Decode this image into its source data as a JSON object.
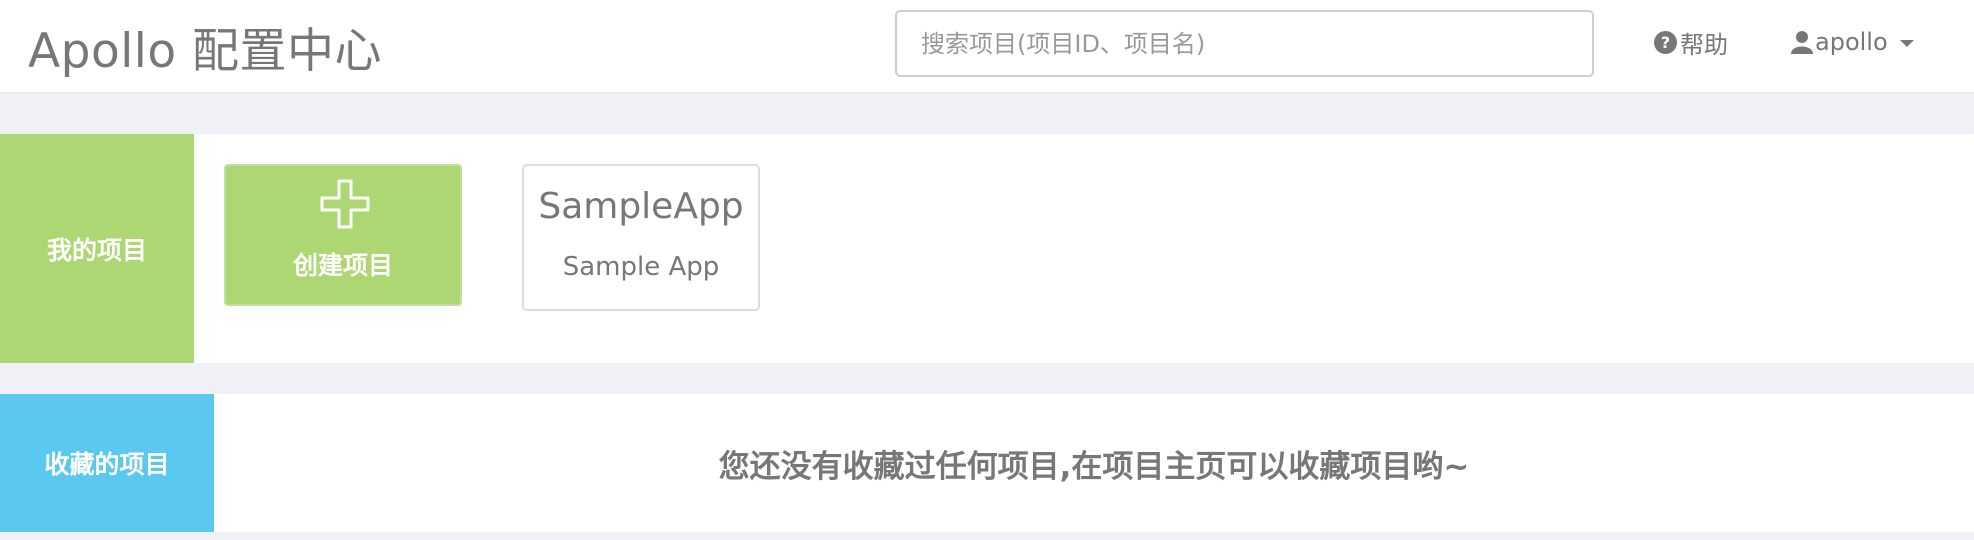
{
  "header": {
    "brand": "Apollo 配置中心",
    "search_placeholder": "搜索项目(项目ID、项目名)",
    "help_label": "帮助",
    "user_label": "apollo"
  },
  "my_projects": {
    "section_label": "我的项目",
    "create_label": "创建项目",
    "apps": [
      {
        "app_id": "SampleApp",
        "name": "Sample App"
      }
    ]
  },
  "favorites": {
    "section_label": "收藏的项目",
    "empty_message": "您还没有收藏过任何项目,在项目主页可以收藏项目哟~"
  },
  "colors": {
    "my_projects_accent": "#acd772",
    "favorites_accent": "#5bc9ef",
    "page_background": "#f0f1f6"
  }
}
